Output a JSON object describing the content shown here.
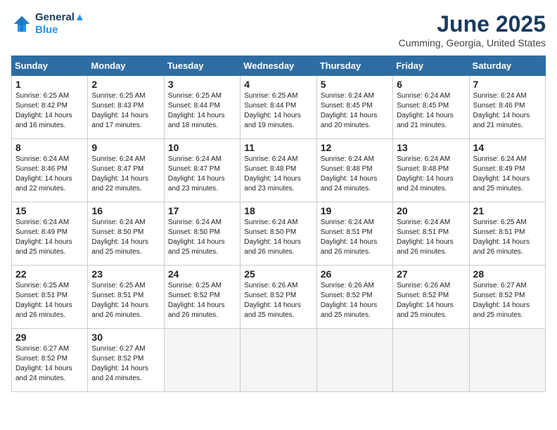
{
  "header": {
    "logo_line1": "General",
    "logo_line2": "Blue",
    "month_title": "June 2025",
    "location": "Cumming, Georgia, United States"
  },
  "columns": [
    "Sunday",
    "Monday",
    "Tuesday",
    "Wednesday",
    "Thursday",
    "Friday",
    "Saturday"
  ],
  "weeks": [
    [
      {
        "day": "1",
        "sunrise": "6:25 AM",
        "sunset": "8:42 PM",
        "daylight": "14 hours and 16 minutes."
      },
      {
        "day": "2",
        "sunrise": "6:25 AM",
        "sunset": "8:43 PM",
        "daylight": "14 hours and 17 minutes."
      },
      {
        "day": "3",
        "sunrise": "6:25 AM",
        "sunset": "8:44 PM",
        "daylight": "14 hours and 18 minutes."
      },
      {
        "day": "4",
        "sunrise": "6:25 AM",
        "sunset": "8:44 PM",
        "daylight": "14 hours and 19 minutes."
      },
      {
        "day": "5",
        "sunrise": "6:24 AM",
        "sunset": "8:45 PM",
        "daylight": "14 hours and 20 minutes."
      },
      {
        "day": "6",
        "sunrise": "6:24 AM",
        "sunset": "8:45 PM",
        "daylight": "14 hours and 21 minutes."
      },
      {
        "day": "7",
        "sunrise": "6:24 AM",
        "sunset": "8:46 PM",
        "daylight": "14 hours and 21 minutes."
      }
    ],
    [
      {
        "day": "8",
        "sunrise": "6:24 AM",
        "sunset": "8:46 PM",
        "daylight": "14 hours and 22 minutes."
      },
      {
        "day": "9",
        "sunrise": "6:24 AM",
        "sunset": "8:47 PM",
        "daylight": "14 hours and 22 minutes."
      },
      {
        "day": "10",
        "sunrise": "6:24 AM",
        "sunset": "8:47 PM",
        "daylight": "14 hours and 23 minutes."
      },
      {
        "day": "11",
        "sunrise": "6:24 AM",
        "sunset": "8:48 PM",
        "daylight": "14 hours and 23 minutes."
      },
      {
        "day": "12",
        "sunrise": "6:24 AM",
        "sunset": "8:48 PM",
        "daylight": "14 hours and 24 minutes."
      },
      {
        "day": "13",
        "sunrise": "6:24 AM",
        "sunset": "8:48 PM",
        "daylight": "14 hours and 24 minutes."
      },
      {
        "day": "14",
        "sunrise": "6:24 AM",
        "sunset": "8:49 PM",
        "daylight": "14 hours and 25 minutes."
      }
    ],
    [
      {
        "day": "15",
        "sunrise": "6:24 AM",
        "sunset": "8:49 PM",
        "daylight": "14 hours and 25 minutes."
      },
      {
        "day": "16",
        "sunrise": "6:24 AM",
        "sunset": "8:50 PM",
        "daylight": "14 hours and 25 minutes."
      },
      {
        "day": "17",
        "sunrise": "6:24 AM",
        "sunset": "8:50 PM",
        "daylight": "14 hours and 25 minutes."
      },
      {
        "day": "18",
        "sunrise": "6:24 AM",
        "sunset": "8:50 PM",
        "daylight": "14 hours and 26 minutes."
      },
      {
        "day": "19",
        "sunrise": "6:24 AM",
        "sunset": "8:51 PM",
        "daylight": "14 hours and 26 minutes."
      },
      {
        "day": "20",
        "sunrise": "6:24 AM",
        "sunset": "8:51 PM",
        "daylight": "14 hours and 26 minutes."
      },
      {
        "day": "21",
        "sunrise": "6:25 AM",
        "sunset": "8:51 PM",
        "daylight": "14 hours and 26 minutes."
      }
    ],
    [
      {
        "day": "22",
        "sunrise": "6:25 AM",
        "sunset": "8:51 PM",
        "daylight": "14 hours and 26 minutes."
      },
      {
        "day": "23",
        "sunrise": "6:25 AM",
        "sunset": "8:51 PM",
        "daylight": "14 hours and 26 minutes."
      },
      {
        "day": "24",
        "sunrise": "6:25 AM",
        "sunset": "8:52 PM",
        "daylight": "14 hours and 26 minutes."
      },
      {
        "day": "25",
        "sunrise": "6:26 AM",
        "sunset": "8:52 PM",
        "daylight": "14 hours and 25 minutes."
      },
      {
        "day": "26",
        "sunrise": "6:26 AM",
        "sunset": "8:52 PM",
        "daylight": "14 hours and 25 minutes."
      },
      {
        "day": "27",
        "sunrise": "6:26 AM",
        "sunset": "8:52 PM",
        "daylight": "14 hours and 25 minutes."
      },
      {
        "day": "28",
        "sunrise": "6:27 AM",
        "sunset": "8:52 PM",
        "daylight": "14 hours and 25 minutes."
      }
    ],
    [
      {
        "day": "29",
        "sunrise": "6:27 AM",
        "sunset": "8:52 PM",
        "daylight": "14 hours and 24 minutes."
      },
      {
        "day": "30",
        "sunrise": "6:27 AM",
        "sunset": "8:52 PM",
        "daylight": "14 hours and 24 minutes."
      },
      null,
      null,
      null,
      null,
      null
    ]
  ]
}
